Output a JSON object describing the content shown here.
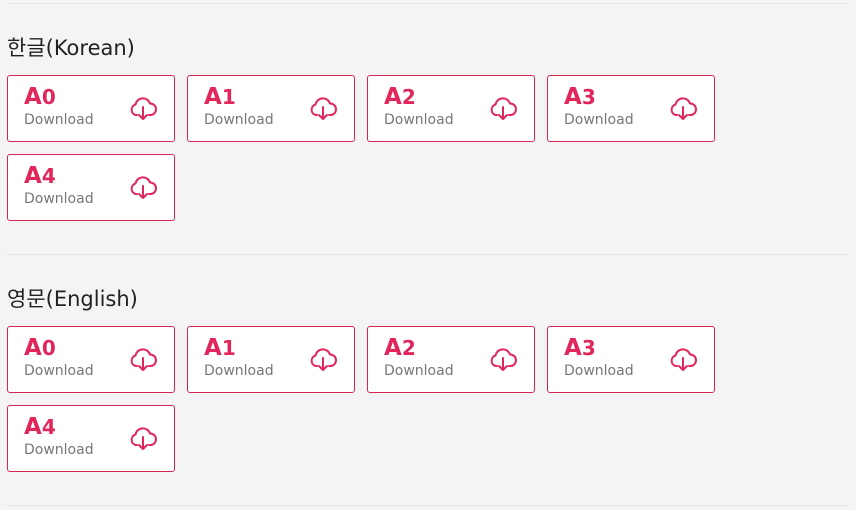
{
  "accent_color": "#e0265a",
  "download_icon": "cloud-download-icon",
  "sections": [
    {
      "title": "한글(Korean)",
      "items": [
        {
          "letter": "A",
          "num": "0",
          "label": "Download"
        },
        {
          "letter": "A",
          "num": "1",
          "label": "Download"
        },
        {
          "letter": "A",
          "num": "2",
          "label": "Download"
        },
        {
          "letter": "A",
          "num": "3",
          "label": "Download"
        },
        {
          "letter": "A",
          "num": "4",
          "label": "Download"
        }
      ]
    },
    {
      "title": "영문(English)",
      "items": [
        {
          "letter": "A",
          "num": "0",
          "label": "Download"
        },
        {
          "letter": "A",
          "num": "1",
          "label": "Download"
        },
        {
          "letter": "A",
          "num": "2",
          "label": "Download"
        },
        {
          "letter": "A",
          "num": "3",
          "label": "Download"
        },
        {
          "letter": "A",
          "num": "4",
          "label": "Download"
        }
      ]
    }
  ]
}
